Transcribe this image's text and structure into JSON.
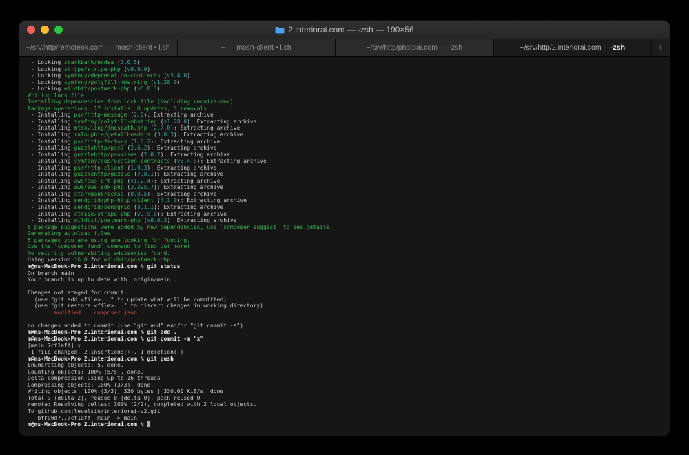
{
  "window": {
    "title": "2.interiorai.com — -zsh — 190×56",
    "new_tab": "+",
    "traffic_lights": {
      "close": "#ff5f57",
      "minimize": "#febc2e",
      "zoom": "#28c840"
    },
    "folder_icon_color": "#4ba2f6",
    "tabs": [
      {
        "label": "~/srv/http/remoteok.com — mosh-client • l.sh",
        "emph": "",
        "active": false
      },
      {
        "label": "~ — mosh-client • l.sh",
        "emph": "",
        "active": false
      },
      {
        "label": "~/srv/http/photoai.com — -zsh",
        "emph": "",
        "active": false
      },
      {
        "label": "~/srv/http/2.interiorai.com — ",
        "emph": "-zsh",
        "active": true
      }
    ]
  },
  "colors": {
    "terminal_bg": "#161616",
    "default_text": "#c9c9c9",
    "green": "#38b44a",
    "version_teal": "#2fa79b",
    "red": "#cc4f40",
    "prompt_bold": "#ededed"
  },
  "terminal": {
    "lines": [
      [
        [
          "d",
          " - Locking "
        ],
        [
          "g",
          "starkbank/ecdsa"
        ],
        [
          "d",
          " ("
        ],
        [
          "t",
          "0.0.5"
        ],
        [
          "d",
          ")"
        ]
      ],
      [
        [
          "d",
          " - Locking "
        ],
        [
          "g",
          "stripe/stripe-php"
        ],
        [
          "d",
          " ("
        ],
        [
          "t",
          "v9.9.0"
        ],
        [
          "d",
          ")"
        ]
      ],
      [
        [
          "d",
          " - Locking "
        ],
        [
          "g",
          "symfony/deprecation-contracts"
        ],
        [
          "d",
          " ("
        ],
        [
          "t",
          "v3.4.0"
        ],
        [
          "d",
          ")"
        ]
      ],
      [
        [
          "d",
          " - Locking "
        ],
        [
          "g",
          "symfony/polyfill-mbstring"
        ],
        [
          "d",
          " ("
        ],
        [
          "t",
          "v1.28.0"
        ],
        [
          "d",
          ")"
        ]
      ],
      [
        [
          "d",
          " - Locking "
        ],
        [
          "g",
          "wildbit/postmark-php"
        ],
        [
          "d",
          " ("
        ],
        [
          "t",
          "v6.0.3"
        ],
        [
          "d",
          ")"
        ]
      ],
      [
        [
          "g",
          "Writing lock file"
        ]
      ],
      [
        [
          "g",
          "Installing dependencies from lock file (including require-dev)"
        ]
      ],
      [
        [
          "g",
          "Package operations: 17 installs, 0 updates, 0 removals"
        ]
      ],
      [
        [
          "d",
          " - Installing "
        ],
        [
          "g",
          "psr/http-message"
        ],
        [
          "d",
          " ("
        ],
        [
          "t",
          "2.0"
        ],
        [
          "d",
          "): Extracting archive"
        ]
      ],
      [
        [
          "d",
          " - Installing "
        ],
        [
          "g",
          "symfony/polyfill-mbstring"
        ],
        [
          "d",
          " ("
        ],
        [
          "t",
          "v1.28.0"
        ],
        [
          "d",
          "): Extracting archive"
        ]
      ],
      [
        [
          "d",
          " - Installing "
        ],
        [
          "g",
          "mtdowling/jmespath.php"
        ],
        [
          "d",
          " ("
        ],
        [
          "t",
          "2.7.0"
        ],
        [
          "d",
          "): Extracting archive"
        ]
      ],
      [
        [
          "d",
          " - Installing "
        ],
        [
          "g",
          "ralouphie/getallheaders"
        ],
        [
          "d",
          " ("
        ],
        [
          "t",
          "3.0.3"
        ],
        [
          "d",
          "): Extracting archive"
        ]
      ],
      [
        [
          "d",
          " - Installing "
        ],
        [
          "g",
          "psr/http-factory"
        ],
        [
          "d",
          " ("
        ],
        [
          "t",
          "1.0.2"
        ],
        [
          "d",
          "): Extracting archive"
        ]
      ],
      [
        [
          "d",
          " - Installing "
        ],
        [
          "g",
          "guzzlehttp/psr7"
        ],
        [
          "d",
          " ("
        ],
        [
          "t",
          "2.6.2"
        ],
        [
          "d",
          "): Extracting archive"
        ]
      ],
      [
        [
          "d",
          " - Installing "
        ],
        [
          "g",
          "guzzlehttp/promises"
        ],
        [
          "d",
          " ("
        ],
        [
          "t",
          "2.0.2"
        ],
        [
          "d",
          "): Extracting archive"
        ]
      ],
      [
        [
          "d",
          " - Installing "
        ],
        [
          "g",
          "symfony/deprecation-contracts"
        ],
        [
          "d",
          " ("
        ],
        [
          "t",
          "v3.4.0"
        ],
        [
          "d",
          "): Extracting archive"
        ]
      ],
      [
        [
          "d",
          " - Installing "
        ],
        [
          "g",
          "psr/http-client"
        ],
        [
          "d",
          " ("
        ],
        [
          "t",
          "1.0.3"
        ],
        [
          "d",
          "): Extracting archive"
        ]
      ],
      [
        [
          "d",
          " - Installing "
        ],
        [
          "g",
          "guzzlehttp/guzzle"
        ],
        [
          "d",
          " ("
        ],
        [
          "t",
          "7.8.1"
        ],
        [
          "d",
          "): Extracting archive"
        ]
      ],
      [
        [
          "d",
          " - Installing "
        ],
        [
          "g",
          "aws/aws-crt-php"
        ],
        [
          "d",
          " ("
        ],
        [
          "t",
          "v1.2.4"
        ],
        [
          "d",
          "): Extracting archive"
        ]
      ],
      [
        [
          "d",
          " - Installing "
        ],
        [
          "g",
          "aws/aws-sdk-php"
        ],
        [
          "d",
          " ("
        ],
        [
          "t",
          "3.295.7"
        ],
        [
          "d",
          "): Extracting archive"
        ]
      ],
      [
        [
          "d",
          " - Installing "
        ],
        [
          "g",
          "starkbank/ecdsa"
        ],
        [
          "d",
          " ("
        ],
        [
          "t",
          "0.0.5"
        ],
        [
          "d",
          "): Extracting archive"
        ]
      ],
      [
        [
          "d",
          " - Installing "
        ],
        [
          "g",
          "sendgrid/php-http-client"
        ],
        [
          "d",
          " ("
        ],
        [
          "t",
          "4.1.0"
        ],
        [
          "d",
          "): Extracting archive"
        ]
      ],
      [
        [
          "d",
          " - Installing "
        ],
        [
          "g",
          "sendgrid/sendgrid"
        ],
        [
          "d",
          " ("
        ],
        [
          "t",
          "8.1.1"
        ],
        [
          "d",
          "): Extracting archive"
        ]
      ],
      [
        [
          "d",
          " - Installing "
        ],
        [
          "g",
          "stripe/stripe-php"
        ],
        [
          "d",
          " ("
        ],
        [
          "t",
          "v9.9.0"
        ],
        [
          "d",
          "): Extracting archive"
        ]
      ],
      [
        [
          "d",
          " - Installing "
        ],
        [
          "g",
          "wildbit/postmark-php"
        ],
        [
          "d",
          " ("
        ],
        [
          "t",
          "v6.0.3"
        ],
        [
          "d",
          "): Extracting archive"
        ]
      ],
      [
        [
          "g",
          "6 package suggestions were added by new dependencies, use `composer suggest` to see details."
        ]
      ],
      [
        [
          "g",
          "Generating autoload files"
        ]
      ],
      [
        [
          "g",
          "5 packages you are using are looking for funding."
        ]
      ],
      [
        [
          "g",
          "Use the `composer fund` command to find out more!"
        ]
      ],
      [
        [
          "g",
          "No security vulnerability advisories found."
        ]
      ],
      [
        [
          "d",
          "Using version "
        ],
        [
          "g",
          "^6.0"
        ],
        [
          "d",
          " for "
        ],
        [
          "g",
          "wildbit/postmark-php"
        ]
      ],
      [
        [
          "b",
          "m@ms-MacBook-Pro 2.interiorai.com % git status"
        ]
      ],
      [
        [
          "d",
          "On branch main"
        ]
      ],
      [
        [
          "d",
          "Your branch is up to date with 'origin/main'."
        ]
      ],
      [],
      [
        [
          "d",
          "Changes not staged for commit:"
        ]
      ],
      [
        [
          "d",
          "  (use \"git add <file>...\" to update what will be committed)"
        ]
      ],
      [
        [
          "d",
          "  (use \"git restore <file>...\" to discard changes in working directory)"
        ]
      ],
      [
        [
          "r",
          "        modified:   composer.json"
        ]
      ],
      [],
      [
        [
          "d",
          "no changes added to commit (use \"git add\" and/or \"git commit -a\")"
        ]
      ],
      [
        [
          "b",
          "m@ms-MacBook-Pro 2.interiorai.com % git add ."
        ]
      ],
      [
        [
          "b",
          "m@ms-MacBook-Pro 2.interiorai.com % git commit -m \"x\""
        ]
      ],
      [
        [
          "d",
          "[main 7cf1aff] x"
        ]
      ],
      [
        [
          "d",
          " 1 file changed, 2 insertions(+), 1 deletion(-)"
        ]
      ],
      [
        [
          "b",
          "m@ms-MacBook-Pro 2.interiorai.com % git push"
        ]
      ],
      [
        [
          "d",
          "Enumerating objects: 5, done."
        ]
      ],
      [
        [
          "d",
          "Counting objects: 100% (5/5), done."
        ]
      ],
      [
        [
          "d",
          "Delta compression using up to 16 threads"
        ]
      ],
      [
        [
          "d",
          "Compressing objects: 100% (3/3), done."
        ]
      ],
      [
        [
          "d",
          "Writing objects: 100% (3/3), 330 bytes | 330.00 KiB/s, done."
        ]
      ],
      [
        [
          "d",
          "Total 3 (delta 2), reused 0 (delta 0), pack-reused 0"
        ]
      ],
      [
        [
          "d",
          "remote: Resolving deltas: 100% (2/2), completed with 2 local objects."
        ]
      ],
      [
        [
          "d",
          "To github.com:levelsio/interiorai-v2.git"
        ]
      ],
      [
        [
          "d",
          "   bff00d7..7cf1aff  main -> main"
        ]
      ],
      [
        [
          "b",
          "m@ms-MacBook-Pro 2.interiorai.com % "
        ],
        [
          "cur",
          ""
        ]
      ]
    ]
  }
}
